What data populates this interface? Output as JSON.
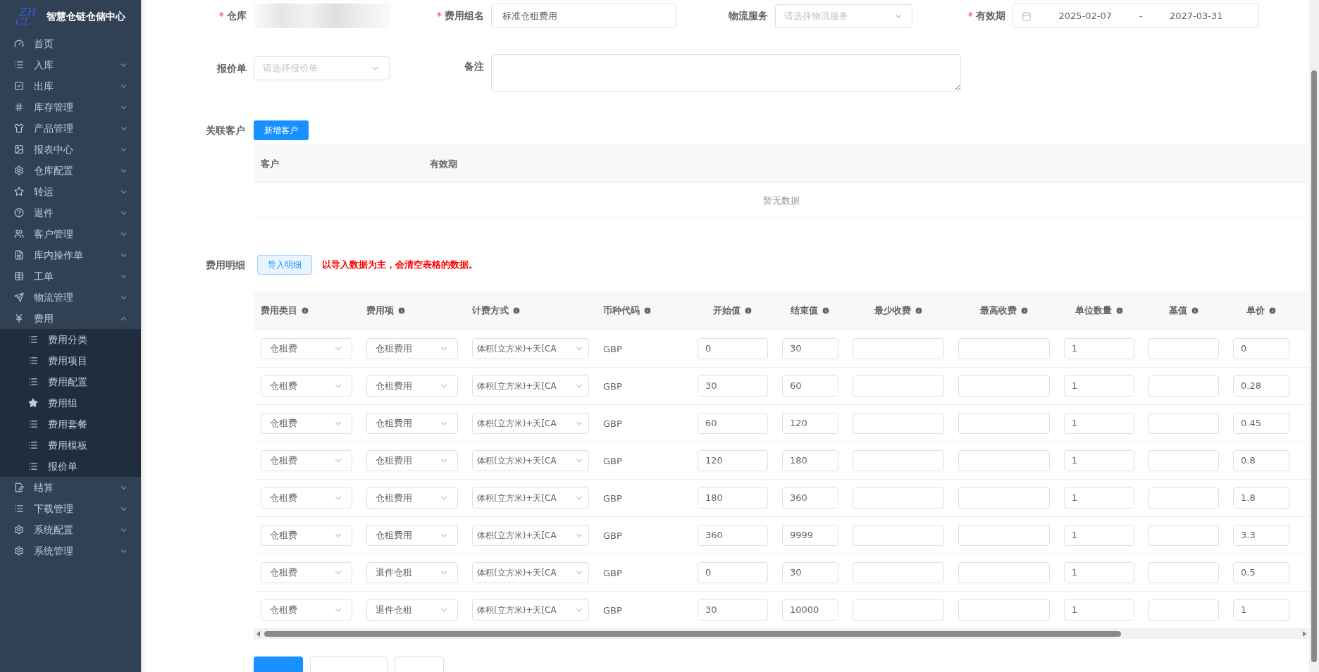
{
  "sidebar": {
    "logo": [
      "ZH",
      "CL"
    ],
    "title": "智慧仓链仓储中心",
    "items": [
      {
        "label": "首页"
      },
      {
        "label": "入库",
        "expanded": false
      },
      {
        "label": "出库",
        "expanded": false
      },
      {
        "label": "库存管理",
        "expanded": false
      },
      {
        "label": "产品管理",
        "expanded": false
      },
      {
        "label": "报表中心",
        "expanded": false
      },
      {
        "label": "仓库配置",
        "expanded": false
      },
      {
        "label": "转运",
        "expanded": false
      },
      {
        "label": "退件",
        "expanded": false
      },
      {
        "label": "客户管理",
        "expanded": false
      },
      {
        "label": "库内操作单",
        "expanded": false
      },
      {
        "label": "工单",
        "expanded": false
      },
      {
        "label": "物流管理",
        "expanded": false
      },
      {
        "label": "费用",
        "expanded": true,
        "children": [
          {
            "label": "费用分类"
          },
          {
            "label": "费用项目"
          },
          {
            "label": "费用配置"
          },
          {
            "label": "费用组"
          },
          {
            "label": "费用套餐"
          },
          {
            "label": "费用模板"
          },
          {
            "label": "报价单"
          }
        ]
      },
      {
        "label": "结算",
        "expanded": false
      },
      {
        "label": "下载管理",
        "expanded": false
      },
      {
        "label": "系统配置",
        "expanded": false
      },
      {
        "label": "系统管理",
        "expanded": false
      }
    ]
  },
  "form": {
    "warehouse": {
      "label": "仓库",
      "required_mark": "*"
    },
    "group_name": {
      "label": "费用组名",
      "required_mark": "*",
      "value": "标准仓租费用"
    },
    "logistics": {
      "label": "物流服务",
      "placeholder": "请选择物流服务"
    },
    "validity": {
      "label": "有效期",
      "required_mark": "*",
      "start": "2025-02-07",
      "separator": "-",
      "end": "2027-03-31"
    },
    "quote": {
      "label": "报价单",
      "placeholder": "请选择报价单"
    },
    "remark": {
      "label": "备注"
    }
  },
  "customers": {
    "label": "关联客户",
    "add_button": "新增客户",
    "columns": [
      "客户",
      "有效期"
    ],
    "empty_text": "暂无数据"
  },
  "details": {
    "label": "费用明细",
    "import_button": "导入明细",
    "notice": "以导入数据为主，会清空表格的数据。",
    "columns": [
      "费用类目",
      "费用项",
      "计费方式",
      "币种代码",
      "开始值",
      "结束值",
      "最少收费",
      "最高收费",
      "单位数量",
      "基值",
      "单价"
    ],
    "rows": [
      {
        "category": "仓租费",
        "item": "仓租费用",
        "method": "体积(立方米)+天[CA",
        "currency": "GBP",
        "start": "0",
        "end": "30",
        "unit_qty": "1",
        "price": "0"
      },
      {
        "category": "仓租费",
        "item": "仓租费用",
        "method": "体积(立方米)+天[CA",
        "currency": "GBP",
        "start": "30",
        "end": "60",
        "unit_qty": "1",
        "price": "0.28"
      },
      {
        "category": "仓租费",
        "item": "仓租费用",
        "method": "体积(立方米)+天[CA",
        "currency": "GBP",
        "start": "60",
        "end": "120",
        "unit_qty": "1",
        "price": "0.45"
      },
      {
        "category": "仓租费",
        "item": "仓租费用",
        "method": "体积(立方米)+天[CA",
        "currency": "GBP",
        "start": "120",
        "end": "180",
        "unit_qty": "1",
        "price": "0.8"
      },
      {
        "category": "仓租费",
        "item": "仓租费用",
        "method": "体积(立方米)+天[CA",
        "currency": "GBP",
        "start": "180",
        "end": "360",
        "unit_qty": "1",
        "price": "1.8"
      },
      {
        "category": "仓租费",
        "item": "仓租费用",
        "method": "体积(立方米)+天[CA",
        "currency": "GBP",
        "start": "360",
        "end": "9999",
        "unit_qty": "1",
        "price": "3.3"
      },
      {
        "category": "仓租费",
        "item": "退件仓租",
        "method": "体积(立方米)+天[CA",
        "currency": "GBP",
        "start": "0",
        "end": "30",
        "unit_qty": "1",
        "price": "0.5"
      },
      {
        "category": "仓租费",
        "item": "退件仓租",
        "method": "体积(立方米)+天[CA",
        "currency": "GBP",
        "start": "30",
        "end": "10000",
        "unit_qty": "1",
        "price": "1"
      }
    ]
  }
}
